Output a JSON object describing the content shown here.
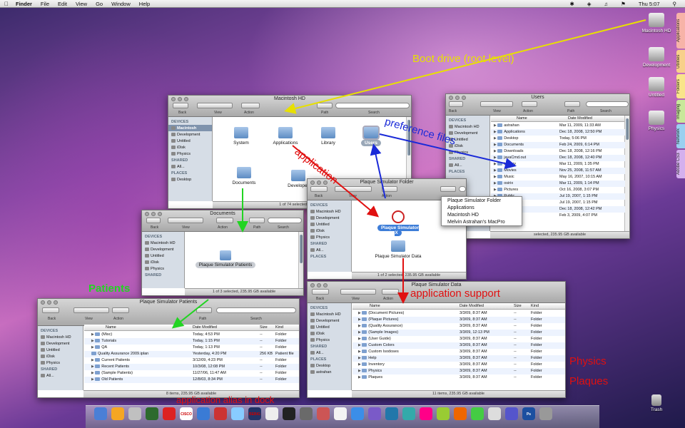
{
  "menubar": {
    "app": "Finder",
    "items": [
      "File",
      "Edit",
      "View",
      "Go",
      "Window",
      "Help"
    ],
    "clock": "Thu 5:07"
  },
  "desktop": {
    "items": [
      "Macintosh HD",
      "Development",
      "Untitled",
      "Physics"
    ],
    "trash": "Trash"
  },
  "stacks": [
    "Applications",
    "Utilities",
    "Folders",
    "Imaging",
    "Network",
    "Adobe CS3"
  ],
  "toolbar": {
    "back": "Back",
    "view": "View",
    "action": "Action",
    "path": "Path",
    "search": "Search"
  },
  "win_hd": {
    "title": "Macintosh HD",
    "status": "1 of 74 selected, 235.95 GB available",
    "sidebar": {
      "devices": "DEVICES",
      "dev_items": [
        "Macintosh",
        "Development",
        "Untitled",
        "iDisk",
        "Physics"
      ],
      "shared": "SHARED",
      "shared_items": [
        "All..."
      ],
      "places": "PLACES",
      "place_items": [
        "Desktop"
      ]
    },
    "icons": [
      "System",
      "Applications",
      "Library",
      "Users",
      "Documents",
      "Developer"
    ]
  },
  "win_users": {
    "title": "Users",
    "status": "selected, 235.95 GB available",
    "sidebar": {
      "devices": "DEVICES",
      "dev_items": [
        "Macintosh HD",
        "Development",
        "Untitled",
        "iDisk",
        "Physics"
      ],
      "shared": "SHARED",
      "shared_items": [
        "All..."
      ],
      "places": "PLACES"
    },
    "header": [
      "Name",
      "Date Modified"
    ],
    "rows": [
      [
        "astrahan",
        "Mar 11, 2009, 11:33 AM"
      ],
      [
        "Applications",
        "Dec 18, 2008, 12:50 PM"
      ],
      [
        "Desktop",
        "Today, 5:06 PM"
      ],
      [
        "Documents",
        "Feb 24, 2009, 6:14 PM"
      ],
      [
        "Downloads",
        "Dec 18, 2008, 12:16 PM"
      ],
      [
        "javaCmd.out",
        "Dec 18, 2008, 12:40 PM"
      ],
      [
        "Library",
        "Mar 11, 2009, 1:35 PM"
      ],
      [
        "Movies",
        "Nov 25, 2008, 11:57 AM"
      ],
      [
        "Music",
        "May 16, 2007, 10:15 AM"
      ],
      [
        "osirix",
        "Mar 11, 2009, 1:14 PM"
      ],
      [
        "Pictures",
        "Oct 16, 2008, 3:07 PM"
      ],
      [
        "Public",
        "Jul 19, 2007, 1:15 PM"
      ],
      [
        "Sites",
        "Jul 19, 2007, 1:15 PM"
      ],
      [
        "Stuffit",
        "Dec 18, 2008, 12:42 PM"
      ],
      [
        "",
        "Feb 3, 2009, 4:07 PM"
      ]
    ]
  },
  "win_docs": {
    "title": "Documents",
    "status": "1 of 3 selected, 235.95 GB available",
    "sidebar": {
      "devices": "DEVICES",
      "dev_items": [
        "Macintosh HD",
        "Development",
        "Untitled",
        "iDisk",
        "Physics"
      ],
      "shared": "SHARED"
    },
    "icon": "Plaque Simulator Patients"
  },
  "win_psf": {
    "title": "Plaque Simulator Folder",
    "status": "1 of 2 selected, 235.95 GB available",
    "sidebar": {
      "devices": "DEVICES",
      "dev_items": [
        "Macintosh HD",
        "Development",
        "Untitled",
        "iDisk",
        "Physics"
      ],
      "shared": "SHARED",
      "shared_items": [
        "All..."
      ],
      "places": "PLACES"
    },
    "app_icon": "Plaque Simulator X",
    "data_icon": "Plaque Simulator Data",
    "popup": [
      "Plaque Simulator Folder",
      "Applications",
      "Macintosh HD",
      "Melvin Astrahan's MacPro"
    ]
  },
  "win_patients": {
    "title": "Plaque Simulator Patients",
    "status": "8 items, 235.95 GB available",
    "sidebar": {
      "devices": "DEVICES",
      "dev_items": [
        "Macintosh HD",
        "Development",
        "Untitled",
        "iDisk",
        "Physics"
      ],
      "shared": "SHARED",
      "shared_items": [
        "All..."
      ]
    },
    "header": [
      "Name",
      "Date Modified",
      "Size",
      "Kind"
    ],
    "rows": [
      [
        "(Misc)",
        "Today, 4:53 PM",
        "--",
        "Folder"
      ],
      [
        "Tutorials",
        "Today, 1:15 PM",
        "--",
        "Folder"
      ],
      [
        "QA",
        "Today, 1:13 PM",
        "--",
        "Folder"
      ],
      [
        "Quality Assurance 2009.iplan",
        "Yesterday, 4:20 PM",
        "256 KB",
        "Patient file"
      ],
      [
        "Current Patients",
        "3/12/09, 4:23 PM",
        "--",
        "Folder"
      ],
      [
        "Recent Patients",
        "10/3/08, 12:08 PM",
        "--",
        "Folder"
      ],
      [
        "(Sample Patients)",
        "11/27/06, 11:47 AM",
        "--",
        "Folder"
      ],
      [
        "Old Patients",
        "12/8/03, 8:34 PM",
        "--",
        "Folder"
      ]
    ]
  },
  "win_data": {
    "title": "Plaque Simulator Data",
    "status": "11 items, 235.95 GB available",
    "sidebar": {
      "devices": "DEVICES",
      "dev_items": [
        "Macintosh HD",
        "Development",
        "Untitled",
        "iDisk",
        "Physics"
      ],
      "shared": "SHARED",
      "shared_items": [
        "All..."
      ],
      "places": "PLACES",
      "place_items": [
        "Desktop",
        "astrahan"
      ]
    },
    "header": [
      "Name",
      "Date Modified",
      "Size",
      "Kind"
    ],
    "rows": [
      [
        "(Document Pictures)",
        "3/3/09, 8:37 AM",
        "--",
        "Folder"
      ],
      [
        "(Plaque Pictures)",
        "3/3/09, 8:37 AM",
        "--",
        "Folder"
      ],
      [
        "(Quality Assurance)",
        "3/3/09, 8:37 AM",
        "--",
        "Folder"
      ],
      [
        "(Sample Images)",
        "3/3/09, 12:13 PM",
        "--",
        "Folder"
      ],
      [
        "(User Guide)",
        "3/3/09, 8:37 AM",
        "--",
        "Folder"
      ],
      [
        "Custom Colors",
        "3/3/09, 8:37 AM",
        "--",
        "Folder"
      ],
      [
        "Custom Isodoses",
        "3/3/09, 8:37 AM",
        "--",
        "Folder"
      ],
      [
        "Help",
        "3/3/09, 8:37 AM",
        "--",
        "Folder"
      ],
      [
        "Inventory",
        "3/3/09, 8:37 AM",
        "--",
        "Folder"
      ],
      [
        "Physics",
        "3/3/09, 8:37 AM",
        "--",
        "Folder"
      ],
      [
        "Plaques",
        "3/3/09, 8:37 AM",
        "--",
        "Folder"
      ]
    ]
  },
  "annotations": {
    "boot": "Boot drive (root level)",
    "prefs": "preference files",
    "application": "application",
    "patients": "Patients",
    "support": "application support",
    "physics": "Physics",
    "plaques": "Plaques",
    "alias": "application alias in dock"
  },
  "colors": {
    "boot": "#e8e000",
    "prefs": "#1a2ad8",
    "application": "#e01010",
    "patients": "#22d422"
  },
  "dock_labels": [
    "CISCO",
    "BEBIG",
    "Ps"
  ]
}
